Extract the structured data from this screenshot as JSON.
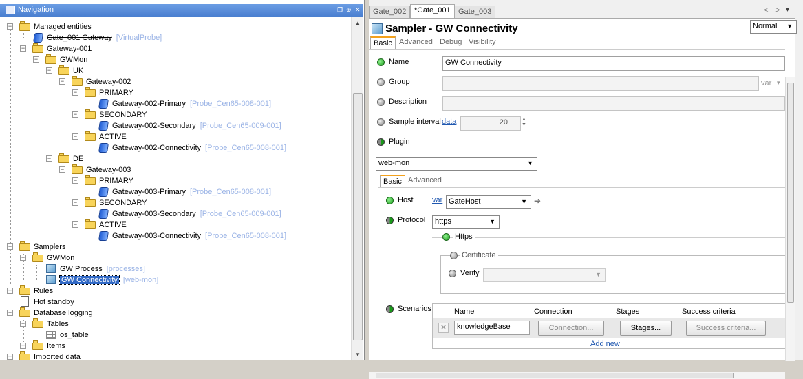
{
  "navigation": {
    "title": "Navigation",
    "tree": [
      {
        "label": "Managed entities",
        "tag": ""
      },
      {
        "label": "Gate_001 Gateway",
        "tag": "[VirtualProbe]"
      },
      {
        "label": "Gateway-001",
        "tag": ""
      },
      {
        "label": "GWMon",
        "tag": ""
      },
      {
        "label": "UK",
        "tag": ""
      },
      {
        "label": "Gateway-002",
        "tag": ""
      },
      {
        "label": "PRIMARY",
        "tag": ""
      },
      {
        "label": "Gateway-002-Primary",
        "tag": "[Probe_Cen65-008-001]"
      },
      {
        "label": "SECONDARY",
        "tag": ""
      },
      {
        "label": "Gateway-002-Secondary",
        "tag": "[Probe_Cen65-009-001]"
      },
      {
        "label": "ACTIVE",
        "tag": ""
      },
      {
        "label": "Gateway-002-Connectivity",
        "tag": "[Probe_Cen65-008-001]"
      },
      {
        "label": "DE",
        "tag": ""
      },
      {
        "label": "Gateway-003",
        "tag": ""
      },
      {
        "label": "PRIMARY",
        "tag": ""
      },
      {
        "label": "Gateway-003-Primary",
        "tag": "[Probe_Cen65-008-001]"
      },
      {
        "label": "SECONDARY",
        "tag": ""
      },
      {
        "label": "Gateway-003-Secondary",
        "tag": "[Probe_Cen65-009-001]"
      },
      {
        "label": "ACTIVE",
        "tag": ""
      },
      {
        "label": "Gateway-003-Connectivity",
        "tag": "[Probe_Cen65-008-001]"
      },
      {
        "label": "Samplers",
        "tag": ""
      },
      {
        "label": "GWMon",
        "tag": ""
      },
      {
        "label": "GW Process",
        "tag": "[processes]"
      },
      {
        "label": "GW Connectivity",
        "tag": "[web-mon]"
      },
      {
        "label": "Rules",
        "tag": ""
      },
      {
        "label": "Hot standby",
        "tag": ""
      },
      {
        "label": "Database logging",
        "tag": ""
      },
      {
        "label": "Tables",
        "tag": ""
      },
      {
        "label": "os_table",
        "tag": ""
      },
      {
        "label": "Items",
        "tag": ""
      },
      {
        "label": "Imported data",
        "tag": ""
      }
    ]
  },
  "editor": {
    "tabs": [
      "Gate_002",
      "*Gate_001",
      "Gate_003"
    ],
    "title": "Sampler - GW Connectivity",
    "mode": "Normal",
    "sub_tabs": [
      "Basic",
      "Advanced",
      "Debug",
      "Visibility"
    ],
    "fields": {
      "name_label": "Name",
      "name_value": "GW Connectivity",
      "group_label": "Group",
      "group_var": "var",
      "description_label": "Description",
      "sample_interval_label": "Sample interval",
      "sample_interval_link": "data",
      "sample_interval_value": "20",
      "plugin_label": "Plugin",
      "plugin_value": "web-mon"
    },
    "plugin_tabs": [
      "Basic",
      "Advanced"
    ],
    "plugin": {
      "host_label": "Host",
      "host_var": "var",
      "host_value": "GateHost",
      "protocol_label": "Protocol",
      "protocol_value": "https",
      "https_label": "Https",
      "certificate_label": "Certificate",
      "verify_label": "Verify",
      "scenarios_label": "Scenarios",
      "columns": [
        "Name",
        "Connection",
        "Stages",
        "Success criteria"
      ],
      "row": {
        "name": "knowledgeBase",
        "connection": "Connection...",
        "stages": "Stages...",
        "success": "Success criteria..."
      },
      "add_new": "Add new"
    }
  }
}
